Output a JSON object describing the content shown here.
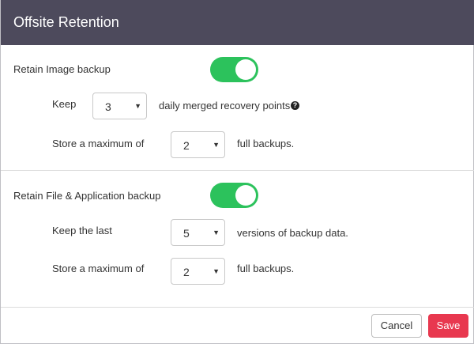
{
  "dialog": {
    "title": "Offsite Retention"
  },
  "image_backup": {
    "label": "Retain Image backup",
    "enabled": true,
    "keep_label": "Keep",
    "keep_value": "3",
    "keep_suffix": "daily merged recovery points",
    "max_label": "Store a maximum of",
    "max_value": "2",
    "max_suffix": "full backups."
  },
  "file_backup": {
    "label": "Retain File & Application backup",
    "enabled": true,
    "keep_label": "Keep the last",
    "keep_value": "5",
    "keep_suffix": "versions of backup data.",
    "max_label": "Store a maximum of",
    "max_value": "2",
    "max_suffix": "full backups."
  },
  "icons": {
    "help": "?",
    "caret": "▼"
  },
  "footer": {
    "cancel_label": "Cancel",
    "save_label": "Save"
  },
  "colors": {
    "titlebar": "#4d4a5c",
    "toggle_on": "#2cc25c",
    "save_button": "#e8384f"
  }
}
